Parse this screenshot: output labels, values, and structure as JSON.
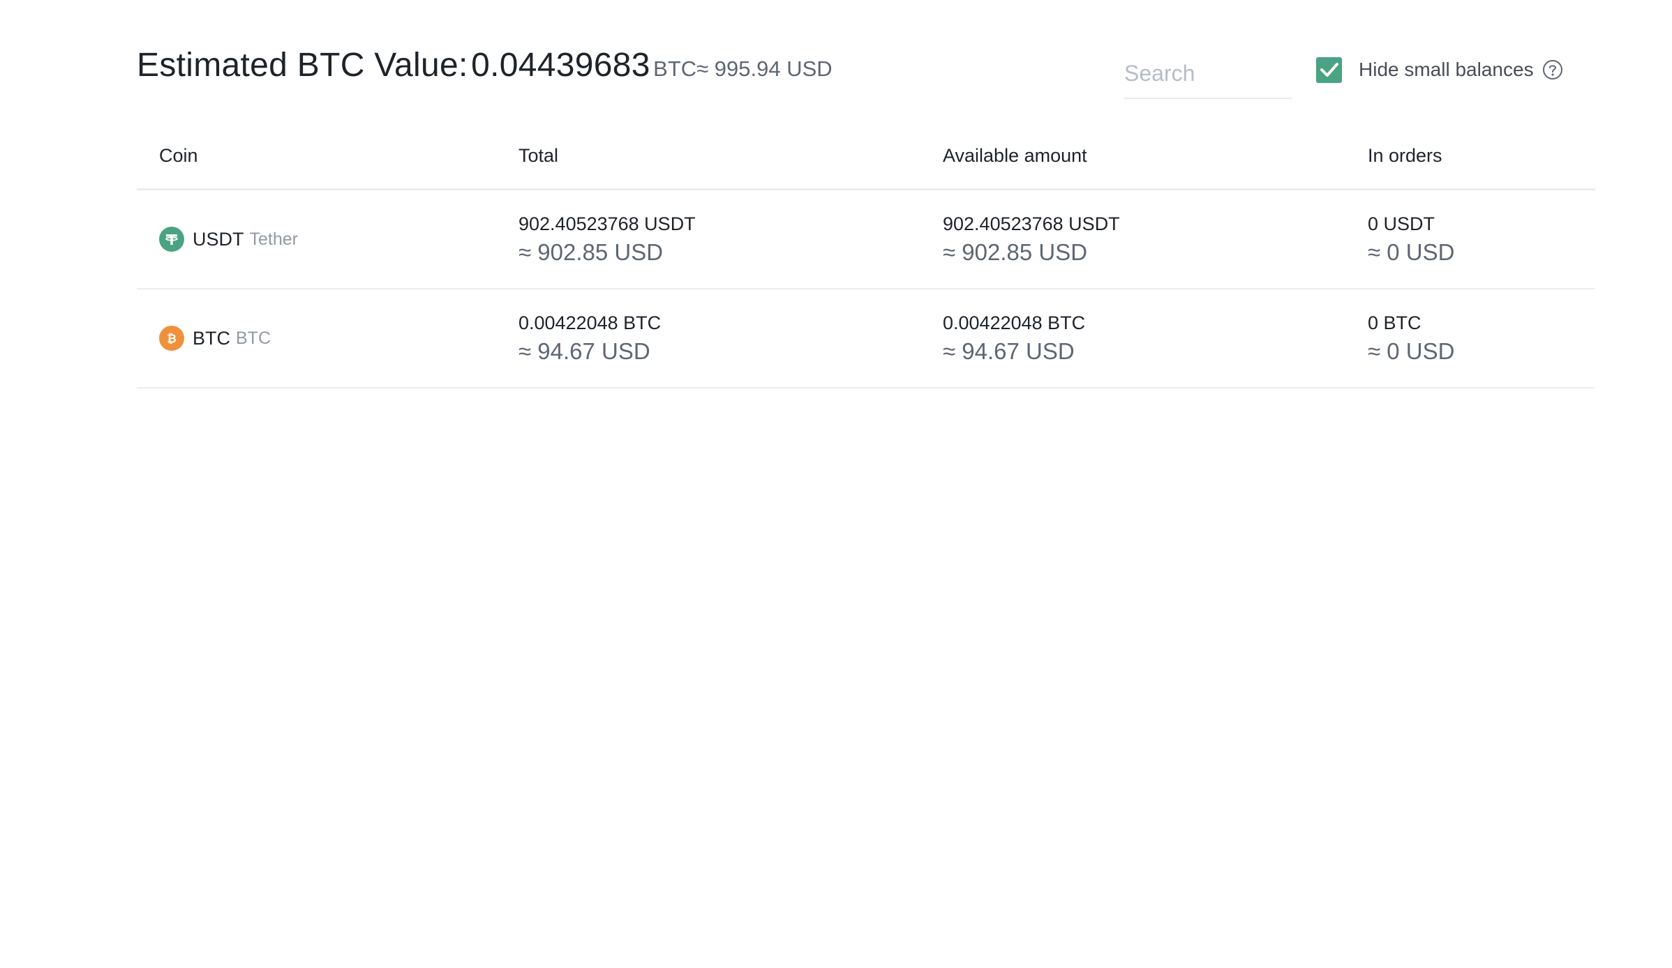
{
  "header": {
    "estimate_label": "Estimated BTC Value:",
    "estimate_value": "0.04439683",
    "estimate_unit": "BTC",
    "estimate_usd": "≈ 995.94 USD"
  },
  "search": {
    "placeholder": "Search",
    "value": ""
  },
  "hide_small_balances": {
    "label": "Hide small balances",
    "checked": true
  },
  "table": {
    "columns": [
      "Coin",
      "Total",
      "Available amount",
      "In orders"
    ],
    "rows": [
      {
        "symbol": "USDT",
        "name": "Tether",
        "icon": "tether-icon",
        "total": "902.40523768 USDT",
        "total_usd": "≈ 902.85 USD",
        "available": "902.40523768 USDT",
        "available_usd": "≈ 902.85 USD",
        "in_orders": "0 USDT",
        "in_orders_usd": "≈ 0 USD"
      },
      {
        "symbol": "BTC",
        "name": "BTC",
        "icon": "bitcoin-icon",
        "total": "0.00422048 BTC",
        "total_usd": "≈ 94.67 USD",
        "available": "0.00422048 BTC",
        "available_usd": "≈ 94.67 USD",
        "in_orders": "0 BTC",
        "in_orders_usd": "≈ 0 USD"
      }
    ]
  },
  "colors": {
    "checkbox": "#4aa383",
    "tether": "#4aa383",
    "bitcoin": "#f0903a"
  }
}
